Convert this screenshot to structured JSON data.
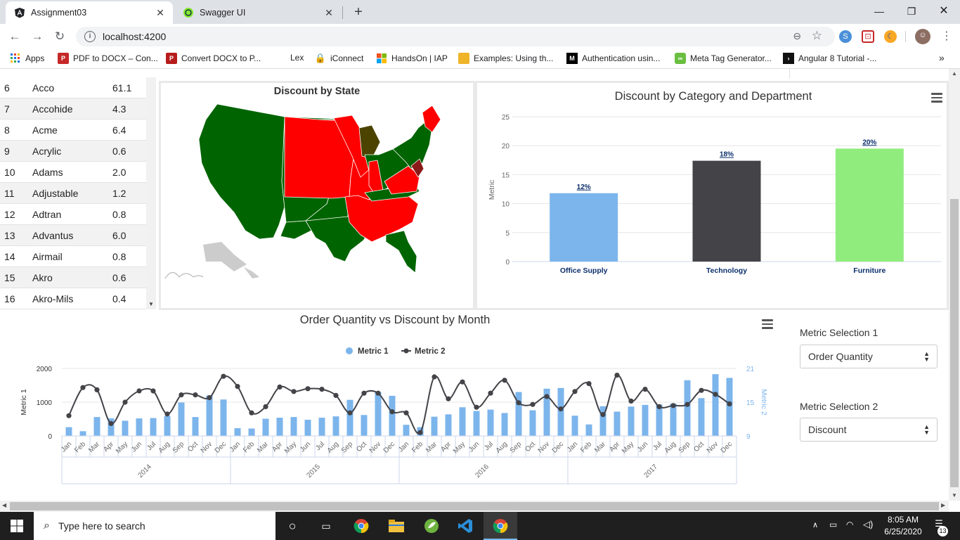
{
  "browser": {
    "tabs": [
      {
        "title": "Assignment03",
        "icon": "angular-icon",
        "active": true
      },
      {
        "title": "Swagger UI",
        "icon": "swagger-icon",
        "active": false
      }
    ],
    "url": "localhost:4200",
    "bookmarks": [
      {
        "label": "Apps",
        "icon": "apps-grid-icon"
      },
      {
        "label": "PDF to DOCX – Con...",
        "icon": "pdf-icon"
      },
      {
        "label": "Convert DOCX to P...",
        "icon": "pdf-icon"
      },
      {
        "label": "Lex",
        "icon": "blank-icon"
      },
      {
        "label": "iConnect",
        "icon": "lock-icon"
      },
      {
        "label": "HandsOn | IAP",
        "icon": "windows-icon"
      },
      {
        "label": "Examples: Using th...",
        "icon": "box-icon"
      },
      {
        "label": "Authentication usin...",
        "icon": "medium-icon"
      },
      {
        "label": "Meta Tag Generator...",
        "icon": "link-icon"
      },
      {
        "label": "Angular 8 Tutorial -...",
        "icon": "code-icon"
      }
    ]
  },
  "table": {
    "rows": [
      {
        "id": "6",
        "name": "Acco",
        "value": "61.1"
      },
      {
        "id": "7",
        "name": "Accohide",
        "value": "4.3"
      },
      {
        "id": "8",
        "name": "Acme",
        "value": "6.4"
      },
      {
        "id": "9",
        "name": "Acrylic",
        "value": "0.6"
      },
      {
        "id": "10",
        "name": "Adams",
        "value": "2.0"
      },
      {
        "id": "11",
        "name": "Adjustable",
        "value": "1.2"
      },
      {
        "id": "12",
        "name": "Adtran",
        "value": "0.8"
      },
      {
        "id": "13",
        "name": "Advantus",
        "value": "6.0"
      },
      {
        "id": "14",
        "name": "Airmail",
        "value": "0.8"
      },
      {
        "id": "15",
        "name": "Akro",
        "value": "0.6"
      },
      {
        "id": "16",
        "name": "Akro-Mils",
        "value": "0.4"
      }
    ]
  },
  "map": {
    "title": "Discount by State"
  },
  "colors": {
    "green": "#006400",
    "red": "#ff0000",
    "olive": "#4d4300",
    "grey": "#cccccc"
  },
  "chart_data": [
    {
      "type": "bar",
      "title": "Discount by Category and Department",
      "ylabel": "Metric",
      "categories": [
        "Office Supply",
        "Technology",
        "Furniture"
      ],
      "values": [
        11.8,
        17.4,
        19.5
      ],
      "data_labels": [
        "12%",
        "18%",
        "20%"
      ],
      "colors": [
        "#7cb5ec",
        "#434348",
        "#90ed7d"
      ],
      "ylim": [
        0,
        25
      ],
      "yticks": [
        0,
        5,
        10,
        15,
        20,
        25
      ],
      "grid": true
    },
    {
      "type": "bar+line",
      "title": "Order Quantity vs Discount by Month",
      "legend": [
        "Metric 1",
        "Metric 2"
      ],
      "legend_position": "top-center",
      "ylabel_left": "Metric 1",
      "ylabel_right": "Metric 2",
      "months": [
        "Jan",
        "Feb",
        "Mar",
        "Apr",
        "May",
        "Jun",
        "Jul",
        "Aug",
        "Sep",
        "Oct",
        "Nov",
        "Dec"
      ],
      "years": [
        "2014",
        "2015",
        "2016",
        "2017"
      ],
      "y1lim": [
        0,
        2000
      ],
      "y1ticks": [
        0,
        1000,
        2000
      ],
      "y2lim": [
        9,
        21
      ],
      "y2ticks": [
        9,
        15,
        21
      ],
      "series": [
        {
          "name": "Metric 1",
          "type": "bar",
          "color": "#7cb5ec",
          "values": [
            260,
            140,
            560,
            520,
            450,
            520,
            530,
            590,
            990,
            560,
            1200,
            1080,
            230,
            220,
            510,
            540,
            560,
            480,
            540,
            580,
            1070,
            620,
            1300,
            1190,
            330,
            260,
            570,
            640,
            850,
            740,
            780,
            680,
            1300,
            760,
            1400,
            1420,
            600,
            340,
            880,
            720,
            870,
            920,
            930,
            960,
            1650,
            1120,
            1830,
            1720
          ]
        },
        {
          "name": "Metric 2",
          "type": "line",
          "color": "#434348",
          "values": [
            12.6,
            17.6,
            17.2,
            11.2,
            15.0,
            17.0,
            17.0,
            12.9,
            16.3,
            16.3,
            15.8,
            19.6,
            17.8,
            13.1,
            14.2,
            17.7,
            16.9,
            17.4,
            17.3,
            16.2,
            13.1,
            16.6,
            16.6,
            13.3,
            13.1,
            9.6,
            19.5,
            15.6,
            18.6,
            14.1,
            16.6,
            18.9,
            14.9,
            14.6,
            16.0,
            13.8,
            16.9,
            18.3,
            12.8,
            19.8,
            15.2,
            17.3,
            14.2,
            14.4,
            14.6,
            17.1,
            16.4,
            14.7
          ]
        }
      ]
    }
  ],
  "selectors": {
    "metric1": {
      "label": "Metric Selection 1",
      "value": "Order Quantity"
    },
    "metric2": {
      "label": "Metric Selection 2",
      "value": "Discount"
    }
  },
  "taskbar": {
    "search_placeholder": "Type here to search",
    "time": "8:05 AM",
    "date": "6/25/2020",
    "notifications": "13"
  }
}
